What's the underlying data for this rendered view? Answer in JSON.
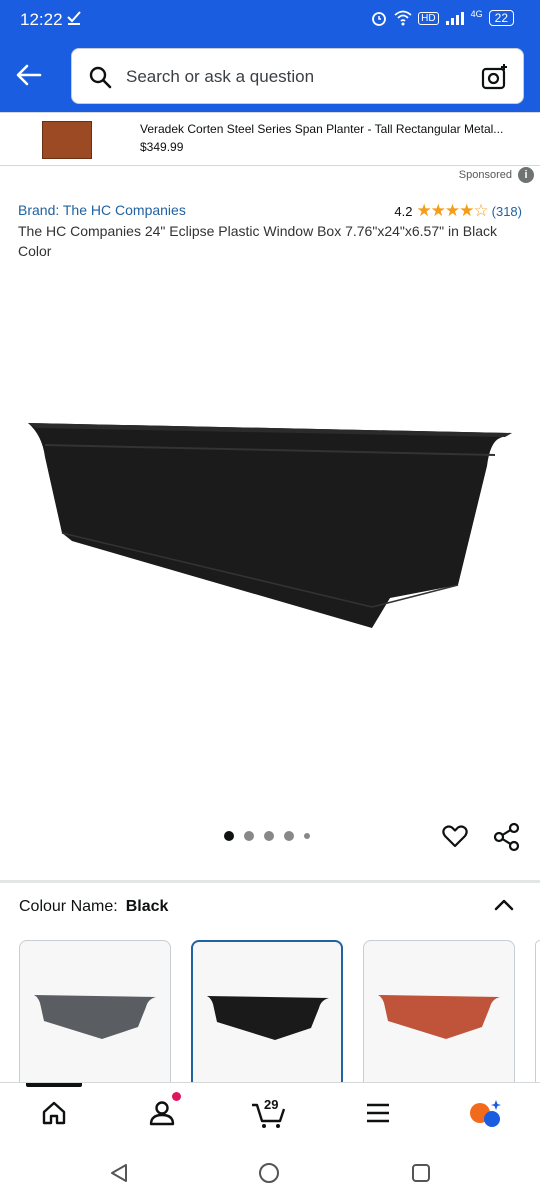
{
  "status_bar": {
    "time": "12:22",
    "network": "4G",
    "battery": "22"
  },
  "search": {
    "placeholder": "Search or ask a question"
  },
  "sponsored_banner": {
    "title": "Veradek Corten Steel Series Span Planter - Tall Rectangular Metal...",
    "price": "$349.99",
    "sponsored_label": "Sponsored"
  },
  "product": {
    "brand": "Brand: The HC Companies",
    "rating": "4.2",
    "stars_filled": 4.2,
    "review_count": "(318)",
    "title": "The HC Companies 24\" Eclipse Plastic Window Box 7.76\"x24\"x6.57\" in Black Color"
  },
  "gallery": {
    "image_count": 5,
    "active_index": 0
  },
  "colour": {
    "label": "Colour Name:",
    "value": "Black",
    "swatches": [
      {
        "name": "Grey",
        "color": "#5a5e63",
        "selected": false
      },
      {
        "name": "Black",
        "color": "#1a1a1a",
        "selected": true
      },
      {
        "name": "Terracotta",
        "color": "#c0543a",
        "selected": false
      }
    ]
  },
  "bottom_nav": {
    "cart_count": "29"
  },
  "colors": {
    "brand_blue": "#1a5de0",
    "link_blue": "#2162a1",
    "star_orange": "#f59d19"
  }
}
